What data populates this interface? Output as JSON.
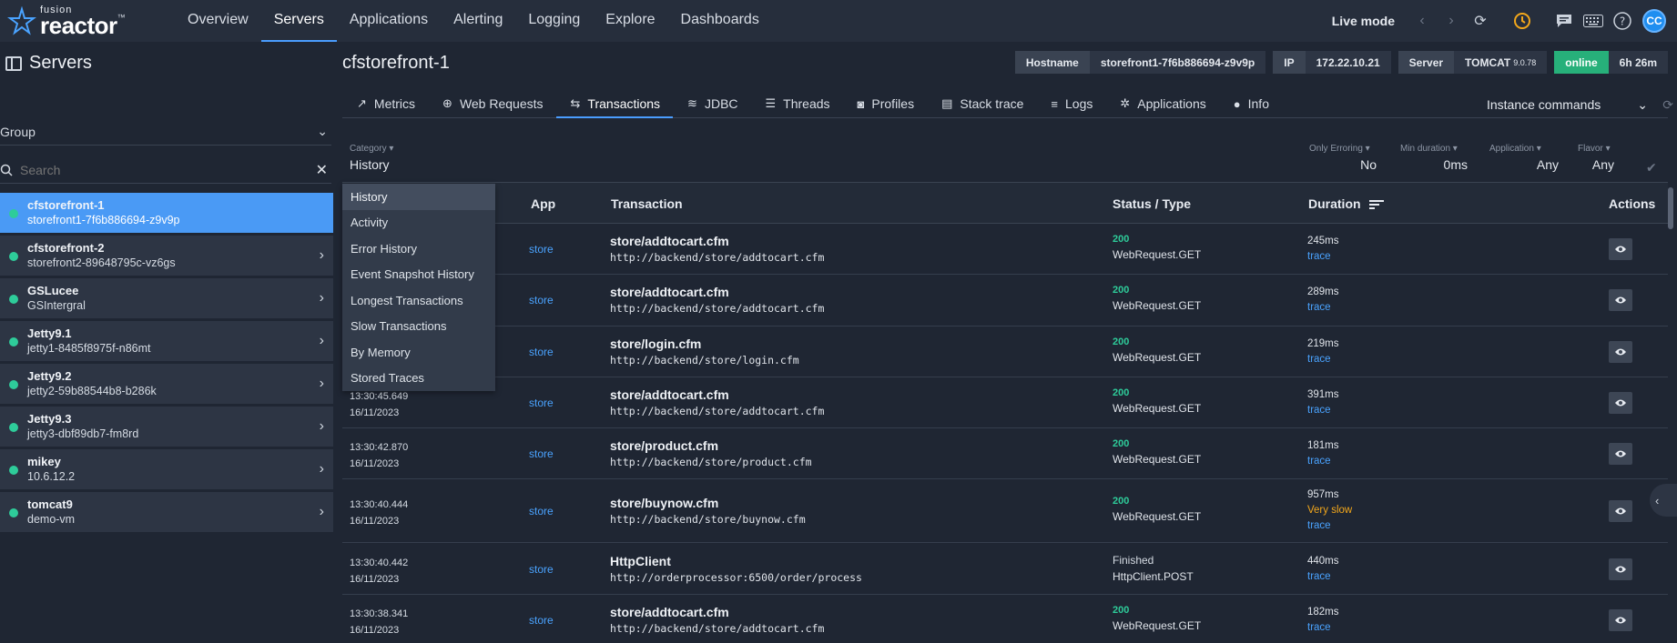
{
  "app": {
    "brand_top": "fusion",
    "brand_main": "reactor",
    "brand_tm": "™"
  },
  "nav": [
    {
      "label": "Overview",
      "active": false
    },
    {
      "label": "Servers",
      "active": true
    },
    {
      "label": "Applications",
      "active": false
    },
    {
      "label": "Alerting",
      "active": false
    },
    {
      "label": "Logging",
      "active": false
    },
    {
      "label": "Explore",
      "active": false
    },
    {
      "label": "Dashboards",
      "active": false
    }
  ],
  "topright": {
    "live_mode": "Live mode",
    "avatar": "CC"
  },
  "sidebar": {
    "title": "Servers",
    "group_label": "Group",
    "search_placeholder": "Search",
    "servers": [
      {
        "name": "cfstorefront-1",
        "sub": "storefront1-7f6b886694-z9v9p",
        "active": true
      },
      {
        "name": "cfstorefront-2",
        "sub": "storefront2-89648795c-vz6gs",
        "active": false
      },
      {
        "name": "GSLucee",
        "sub": "GSIntergral",
        "active": false
      },
      {
        "name": "Jetty9.1",
        "sub": "jetty1-8485f8975f-n86mt",
        "active": false
      },
      {
        "name": "Jetty9.2",
        "sub": "jetty2-59b88544b8-b286k",
        "active": false
      },
      {
        "name": "Jetty9.3",
        "sub": "jetty3-dbf89db7-fm8rd",
        "active": false
      },
      {
        "name": "mikey",
        "sub": "10.6.12.2",
        "active": false
      },
      {
        "name": "tomcat9",
        "sub": "demo-vm",
        "active": false
      }
    ]
  },
  "main": {
    "title": "cfstorefront-1",
    "meta": {
      "hostname_label": "Hostname",
      "hostname": "storefront1-7f6b886694-z9v9p",
      "ip_label": "IP",
      "ip": "172.22.10.21",
      "server_label": "Server",
      "server": "TOMCAT",
      "server_version": "9.0.78",
      "status": "online",
      "uptime": "6h 26m"
    },
    "tabs": [
      {
        "label": "Metrics",
        "icon": "↗"
      },
      {
        "label": "Web Requests",
        "icon": "⊕"
      },
      {
        "label": "Transactions",
        "icon": "⇆"
      },
      {
        "label": "JDBC",
        "icon": "≋"
      },
      {
        "label": "Threads",
        "icon": "☰"
      },
      {
        "label": "Profiles",
        "icon": "◙"
      },
      {
        "label": "Stack trace",
        "icon": "▤"
      },
      {
        "label": "Logs",
        "icon": "≡"
      },
      {
        "label": "Applications",
        "icon": "✲"
      },
      {
        "label": "Info",
        "icon": "●"
      }
    ],
    "instance_commands": "Instance commands",
    "filters": {
      "category_label": "Category",
      "category": "History",
      "erroring_label": "Only Erroring",
      "erroring": "No",
      "duration_label": "Min duration",
      "duration": "0ms",
      "application_label": "Application",
      "application": "Any",
      "flavor_label": "Flavor",
      "flavor": "Any"
    },
    "columns": {
      "app": "App",
      "transaction": "Transaction",
      "status": "Status / Type",
      "duration": "Duration",
      "actions": "Actions"
    },
    "rows": [
      {
        "time": "",
        "date": "",
        "app": "store",
        "tx": "store/addtocart.cfm",
        "url": "http://backend/store/addtocart.cfm",
        "code": "200",
        "type": "WebRequest.GET",
        "dur": "245ms",
        "slow": "",
        "trace": "trace"
      },
      {
        "time": "",
        "date": "",
        "app": "store",
        "tx": "store/addtocart.cfm",
        "url": "http://backend/store/addtocart.cfm",
        "code": "200",
        "type": "WebRequest.GET",
        "dur": "289ms",
        "slow": "",
        "trace": "trace"
      },
      {
        "time": "",
        "date": "",
        "app": "store",
        "tx": "store/login.cfm",
        "url": "http://backend/store/login.cfm",
        "code": "200",
        "type": "WebRequest.GET",
        "dur": "219ms",
        "slow": "",
        "trace": "trace"
      },
      {
        "time": "13:30:45.649",
        "date": "16/11/2023",
        "app": "store",
        "tx": "store/addtocart.cfm",
        "url": "http://backend/store/addtocart.cfm",
        "code": "200",
        "type": "WebRequest.GET",
        "dur": "391ms",
        "slow": "",
        "trace": "trace"
      },
      {
        "time": "13:30:42.870",
        "date": "16/11/2023",
        "app": "store",
        "tx": "store/product.cfm",
        "url": "http://backend/store/product.cfm",
        "code": "200",
        "type": "WebRequest.GET",
        "dur": "181ms",
        "slow": "",
        "trace": "trace"
      },
      {
        "time": "13:30:40.444",
        "date": "16/11/2023",
        "app": "store",
        "tx": "store/buynow.cfm",
        "url": "http://backend/store/buynow.cfm",
        "code": "200",
        "type": "WebRequest.GET",
        "dur": "957ms",
        "slow": "Very slow",
        "trace": "trace"
      },
      {
        "time": "13:30:40.442",
        "date": "16/11/2023",
        "app": "store",
        "tx": "HttpClient",
        "url": "http://orderprocessor:6500/order/process",
        "code": "Finished",
        "type": "HttpClient.POST",
        "dur": "440ms",
        "slow": "",
        "trace": "trace"
      },
      {
        "time": "13:30:38.341",
        "date": "16/11/2023",
        "app": "store",
        "tx": "store/addtocart.cfm",
        "url": "http://backend/store/addtocart.cfm",
        "code": "200",
        "type": "WebRequest.GET",
        "dur": "182ms",
        "slow": "",
        "trace": "trace"
      }
    ]
  },
  "dropdown": {
    "items": [
      "History",
      "Activity",
      "Error History",
      "Event Snapshot History",
      "Longest Transactions",
      "Slow Transactions",
      "By Memory",
      "Stored Traces"
    ],
    "selected": 0
  }
}
